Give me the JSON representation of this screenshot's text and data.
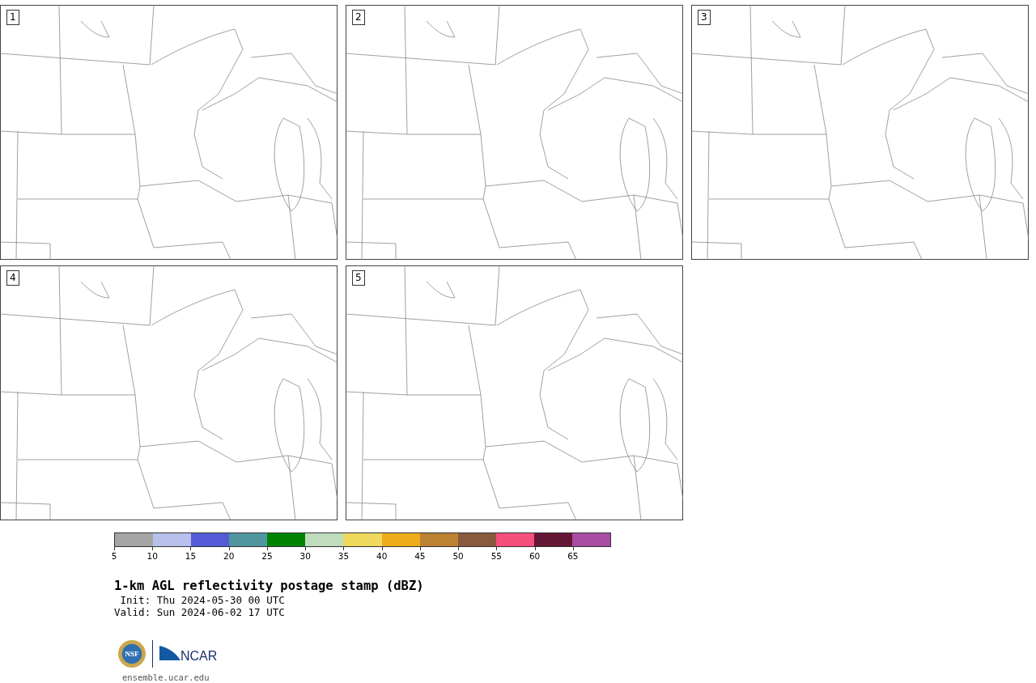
{
  "panels": [
    {
      "label": "1"
    },
    {
      "label": "2"
    },
    {
      "label": "3"
    },
    {
      "label": "4"
    },
    {
      "label": "5"
    }
  ],
  "colorbar": {
    "segments": [
      {
        "label": "5",
        "color": "#a5a5a5"
      },
      {
        "label": "10",
        "color": "#b8c1ec"
      },
      {
        "label": "15",
        "color": "#535cd6"
      },
      {
        "label": "20",
        "color": "#50969f"
      },
      {
        "label": "25",
        "color": "#008300"
      },
      {
        "label": "30",
        "color": "#bfdcbd"
      },
      {
        "label": "35",
        "color": "#efd85e"
      },
      {
        "label": "40",
        "color": "#eeac1a"
      },
      {
        "label": "45",
        "color": "#bb8232"
      },
      {
        "label": "50",
        "color": "#8a5a3e"
      },
      {
        "label": "55",
        "color": "#f44f7d"
      },
      {
        "label": "60",
        "color": "#641635"
      },
      {
        "label": "65",
        "color": "#aa4ba5"
      }
    ]
  },
  "title": "1-km AGL reflectivity postage stamp (dBZ)",
  "init": " Init: Thu 2024-05-30 00 UTC",
  "valid": "Valid: Sun 2024-06-02 17 UTC",
  "logos": {
    "seal": "NSF",
    "org": "NCAR"
  },
  "url": "ensemble.ucar.edu"
}
